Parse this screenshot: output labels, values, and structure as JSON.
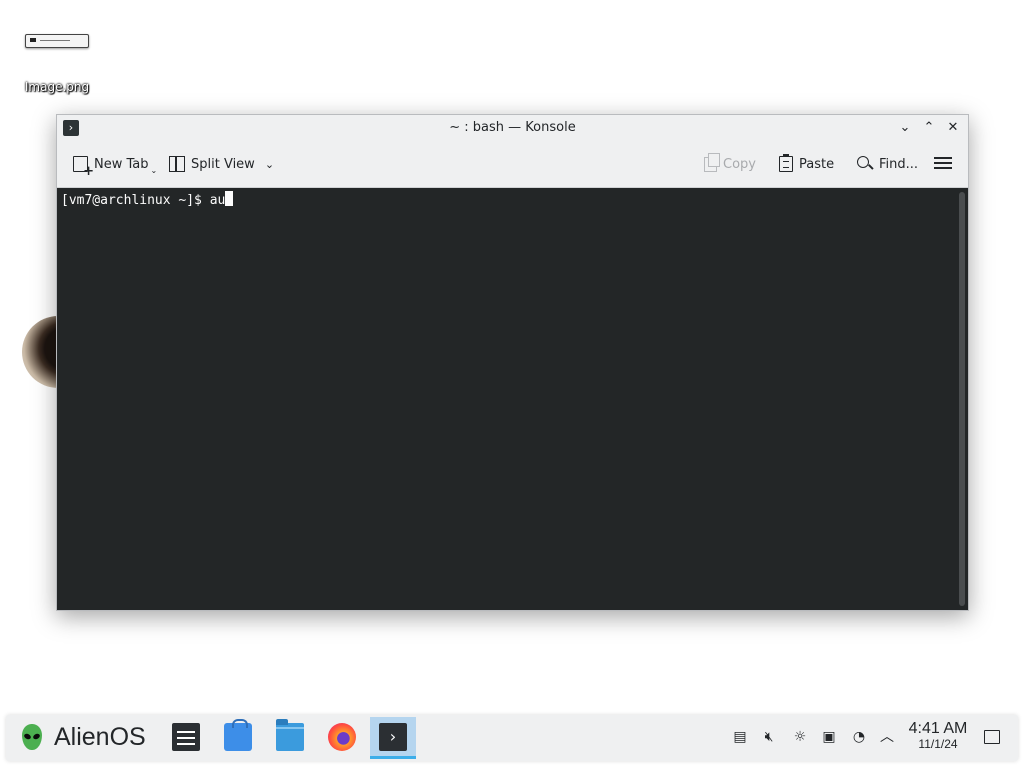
{
  "desktop": {
    "icons": [
      {
        "label": "Image.png",
        "icon": "image-file-icon"
      }
    ]
  },
  "window": {
    "title": "~ : bash — Konsole",
    "app_icon": "konsole-icon",
    "controls": {
      "minimize": "⌄",
      "maximize": "⌃",
      "close": "✕"
    },
    "toolbar": {
      "new_tab": "New Tab",
      "split_view": "Split View",
      "copy": "Copy",
      "paste": "Paste",
      "find": "Find..."
    },
    "terminal": {
      "prompt": "[vm7@archlinux ~]$ ",
      "input": "au"
    }
  },
  "taskbar": {
    "launcher_label": "AlienOS",
    "tasks": [
      {
        "name": "system-settings-icon",
        "active": false
      },
      {
        "name": "discover-store-icon",
        "active": false
      },
      {
        "name": "file-manager-icon",
        "active": false
      },
      {
        "name": "firefox-icon",
        "active": false
      },
      {
        "name": "konsole-icon",
        "active": true
      }
    ],
    "tray": [
      "clipboard-icon",
      "volume-muted-icon",
      "brightness-icon",
      "storage-icon",
      "updates-icon",
      "expand-tray-icon"
    ],
    "clock": {
      "time": "4:41 AM",
      "date": "11/1/24"
    }
  },
  "colors": {
    "terminal_bg": "#232627",
    "terminal_fg": "#fcfcfc",
    "window_bg": "#eff0f1",
    "active_task": "#b5d5ef",
    "accent": "#3daee9"
  }
}
